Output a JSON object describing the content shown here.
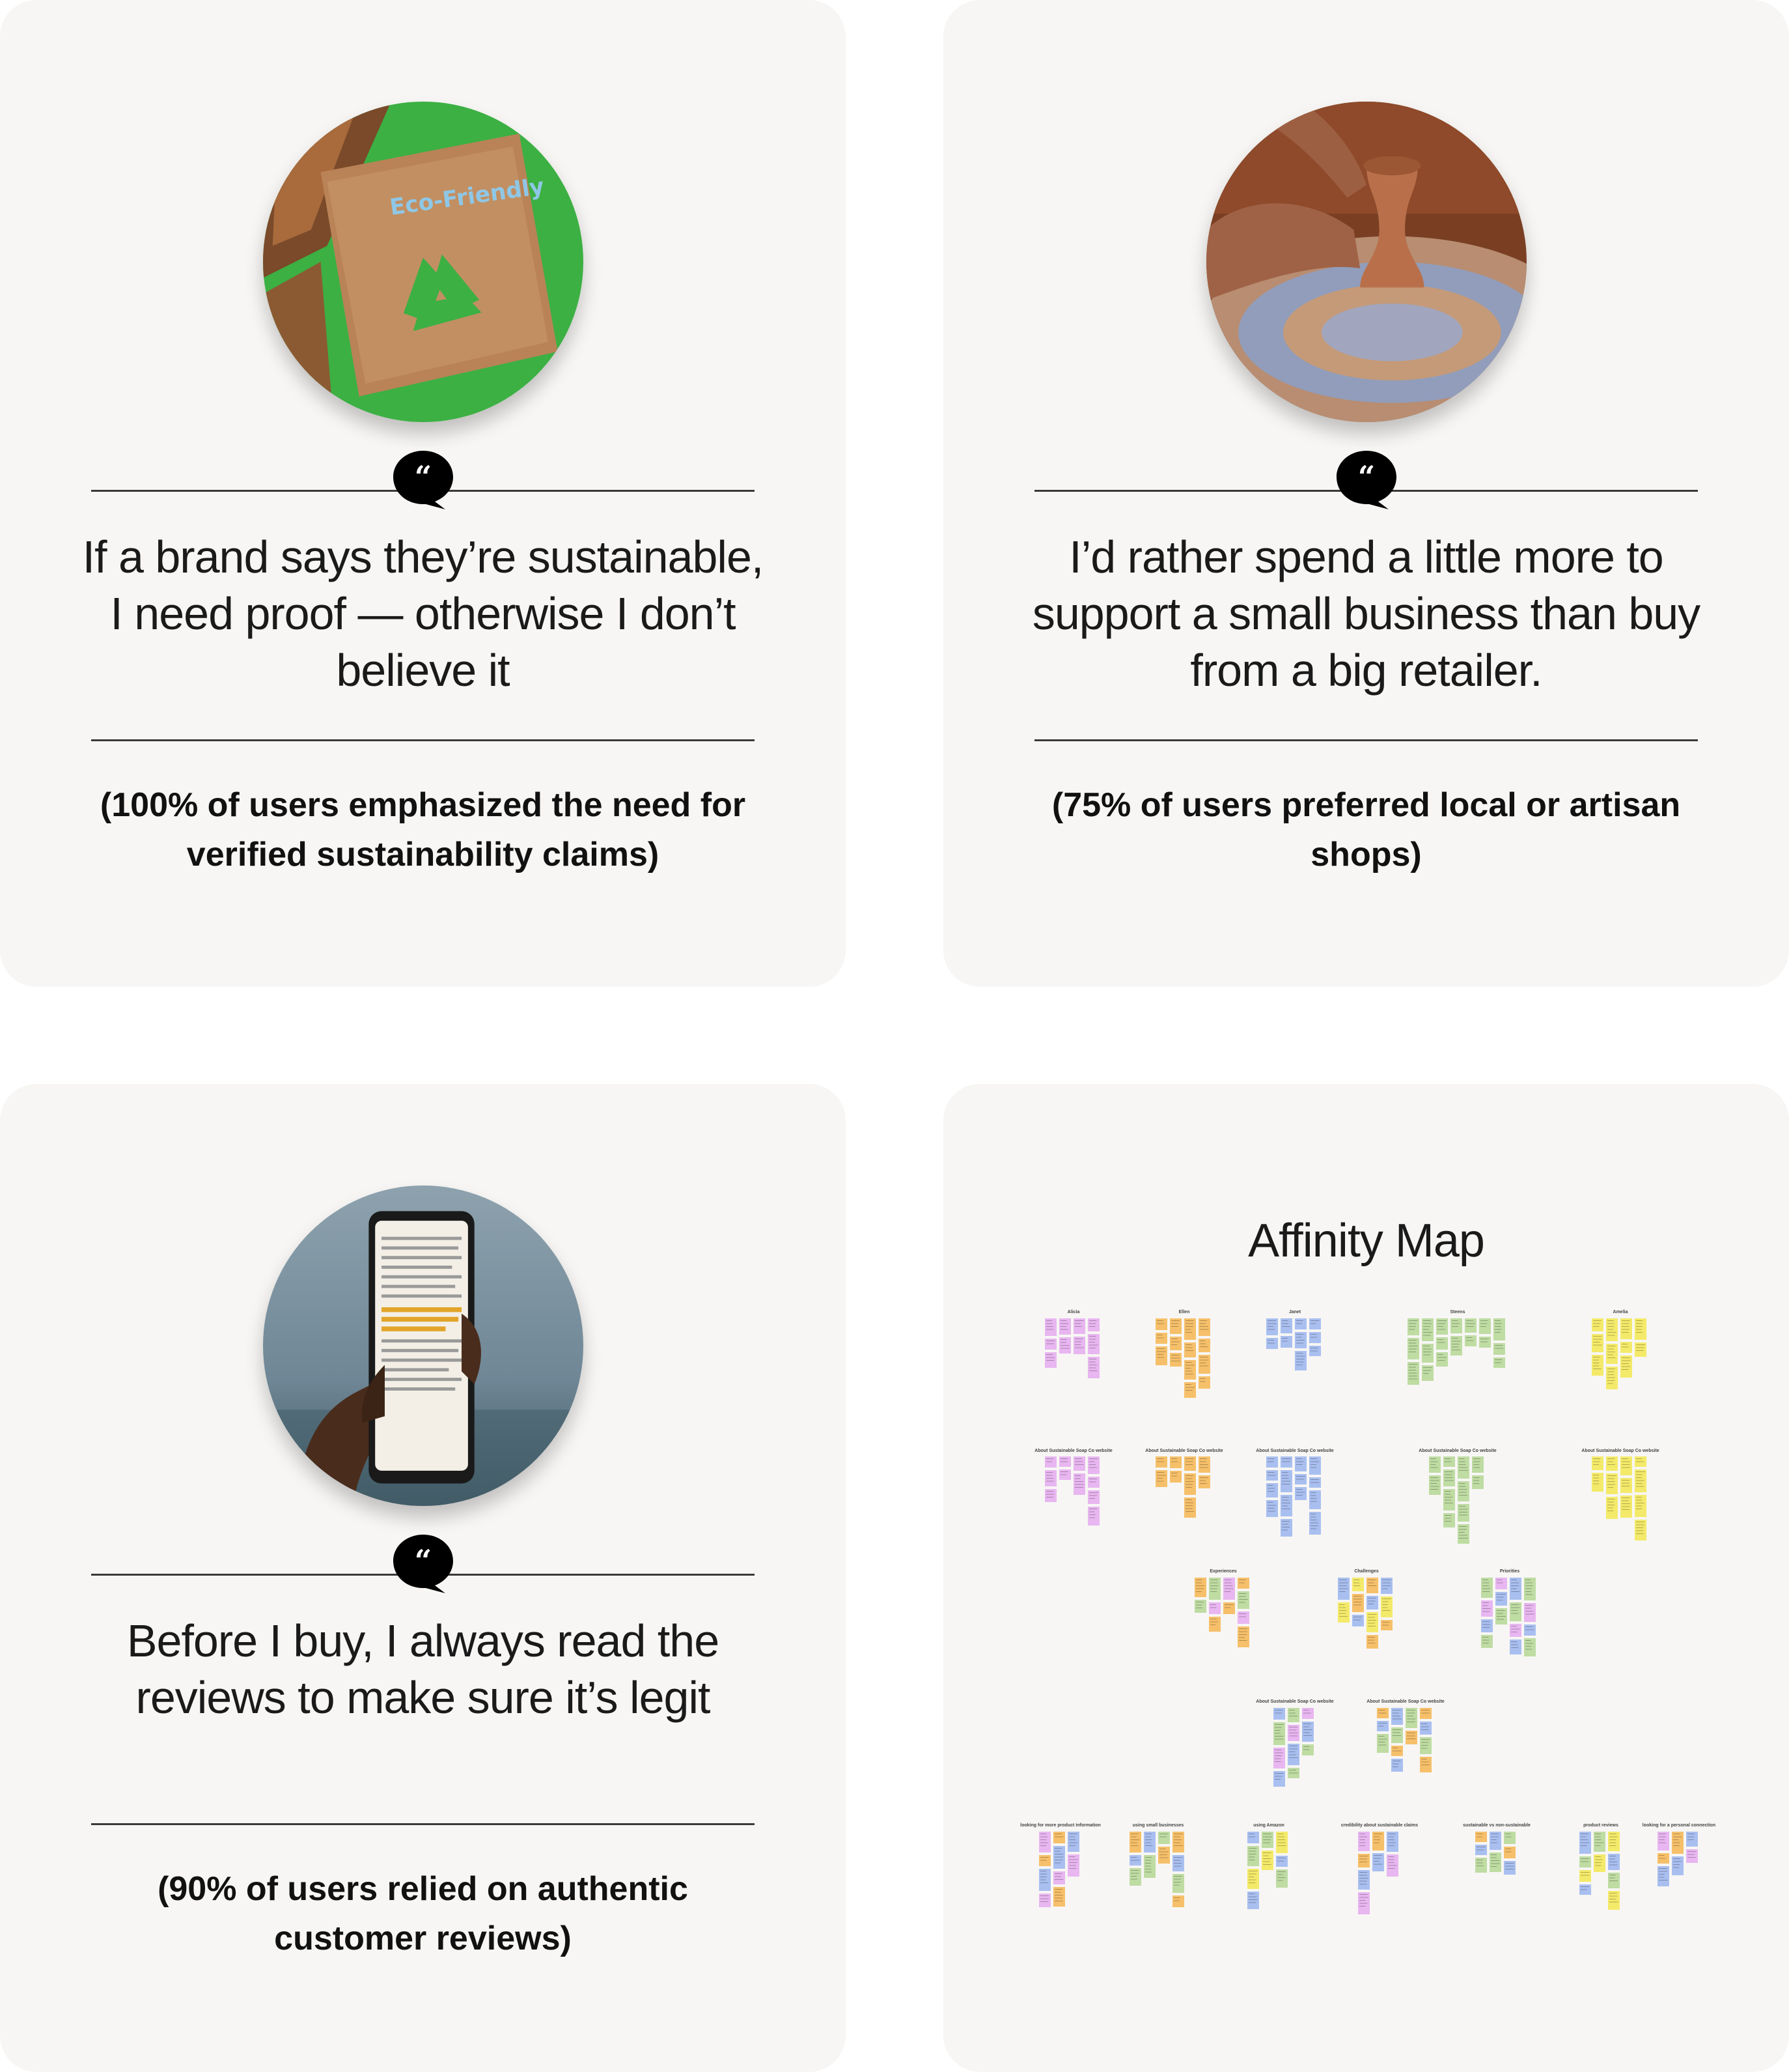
{
  "cards": [
    {
      "quote": "If a brand says they’re sustainable, I need proof — otherwise I don’t believe it",
      "stat": "(100% of users emphasized the need for verified sustainability claims)",
      "image": "eco-friendly-recycle-packaging",
      "image_text": "Eco-Friendly"
    },
    {
      "quote": "I’d rather spend a little more to support a small business than buy from a big retailer.",
      "stat": "(75% of users preferred local or artisan shops)",
      "image": "hands-on-pottery-wheel"
    },
    {
      "quote": "Before I buy, I always read the reviews to make sure it’s legit",
      "stat": "(90% of users relied on authentic customer reviews)",
      "image": "hand-holding-phone-reading"
    }
  ],
  "affinity": {
    "title": "Affinity Map",
    "participants": [
      "Alicia",
      "Ellen",
      "Janet",
      "Steens",
      "Amelia"
    ],
    "about_label": "About Sustainable Soap Co website",
    "themes": [
      "Experiences",
      "Challenges",
      "Priorities"
    ],
    "categories": [
      "looking for more product information",
      "using small businesses",
      "using Amazon",
      "credibility about sustainable claims",
      "sustainable vs non-sustainable",
      "product reviews",
      "looking for a personal connection"
    ]
  },
  "colors": {
    "card_bg": "#f7f6f4",
    "note_pink": "#e8b6f0",
    "note_orange": "#f6c06a",
    "note_blue": "#a9bff0",
    "note_green": "#bfdca3",
    "note_yellow": "#f4ea6a"
  }
}
